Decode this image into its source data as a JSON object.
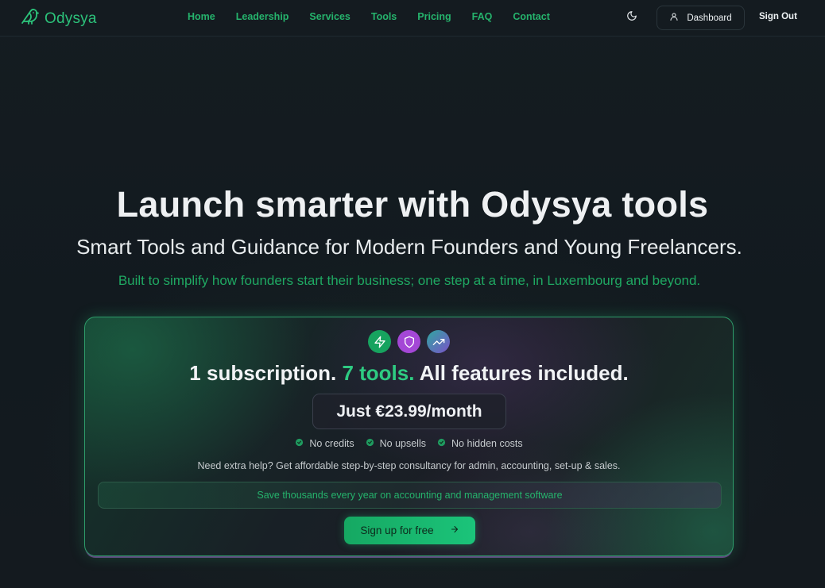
{
  "brand": {
    "name": "Odysya",
    "logo_icon": "bird-icon"
  },
  "nav": {
    "links": [
      "Home",
      "Leadership",
      "Services",
      "Tools",
      "Pricing",
      "FAQ",
      "Contact"
    ],
    "theme_icon": "moon-icon",
    "dashboard_label": "Dashboard",
    "dashboard_icon": "user-icon",
    "signout_label": "Sign Out"
  },
  "hero": {
    "title": "Launch smarter with Odysya tools",
    "subtitle": "Smart Tools and Guidance for Modern Founders and Young Freelancers.",
    "tagline": "Built to simplify how founders start their business; one step at a time, in Luxembourg and beyond."
  },
  "offer": {
    "icons": [
      "zap-icon",
      "shield-icon",
      "trending-up-icon"
    ],
    "headline_part1": "1 subscription.",
    "headline_accent": "7 tools.",
    "headline_part2": "All features included.",
    "price": "Just €23.99/month",
    "checks": [
      "No credits",
      "No upsells",
      "No hidden costs"
    ],
    "help": "Need extra help? Get affordable step-by-step consultancy for admin, accounting, set-up & sales.",
    "save": "Save thousands every year on accounting and management software",
    "cta_label": "Sign up for free",
    "cta_icon": "arrow-right-icon"
  },
  "colors": {
    "background": "#131a1f",
    "accent_green": "#25b36c",
    "accent_purple": "#a447d6"
  }
}
